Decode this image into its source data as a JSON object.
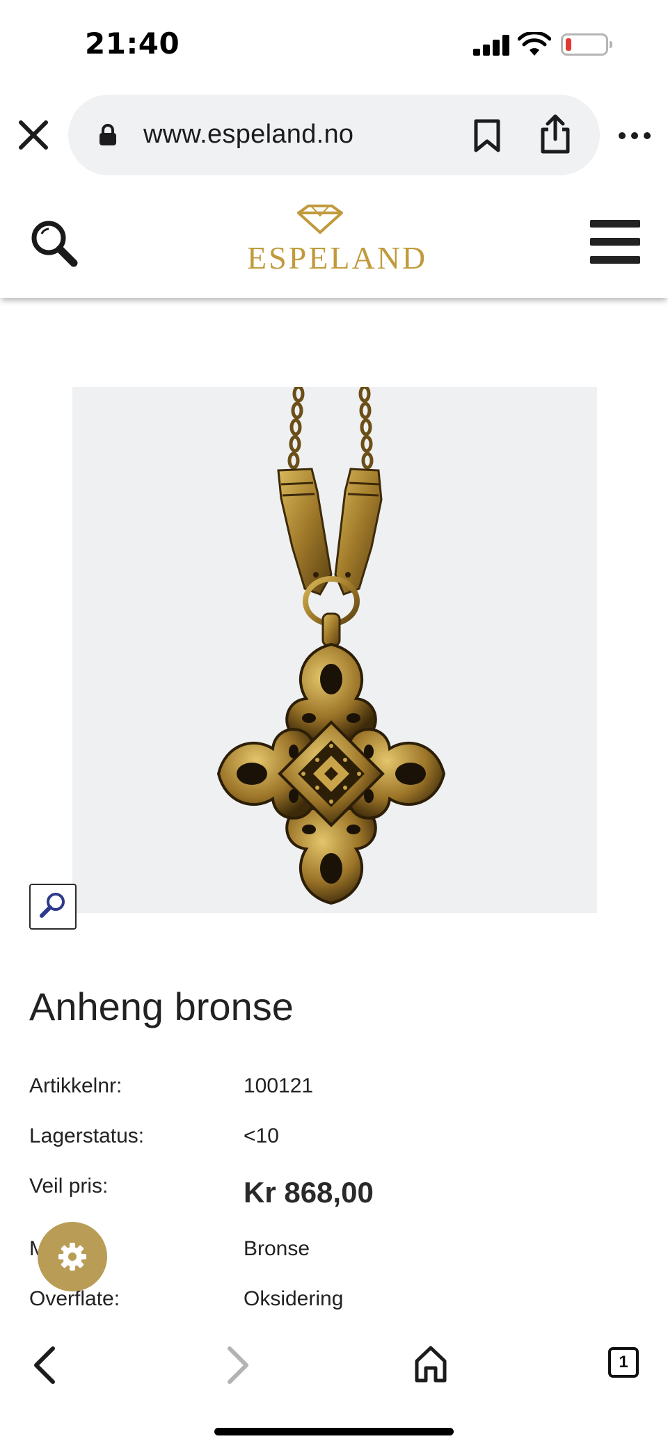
{
  "status_bar": {
    "time": "21:40",
    "battery_state": "low",
    "battery_color": "#e33a2f"
  },
  "browser": {
    "url": "www.espeland.no",
    "close_icon": "close-icon",
    "lock_icon": "lock-icon",
    "bookmark_icon": "bookmark-icon",
    "share_icon": "share-icon",
    "more_icon": "more-icon"
  },
  "site_header": {
    "logo_text": "ESPELAND",
    "brand_color": "#c09a3c",
    "search_icon": "search-icon",
    "menu_icon": "hamburger-menu-icon"
  },
  "product": {
    "title": "Anheng bronse",
    "image_alt": "pendant-image",
    "details": [
      {
        "label": "Artikkelnr:",
        "value": "100121"
      },
      {
        "label": "Lagerstatus:",
        "value": "<10"
      },
      {
        "label": "Veil pris:",
        "value": "Kr 868,00"
      },
      {
        "label": "M",
        "value": "Bronse"
      },
      {
        "label": "Overflate:",
        "value": "Oksidering"
      }
    ]
  },
  "bottom_bar": {
    "tab_count": "1",
    "back_icon": "chevron-left-icon",
    "forward_icon": "chevron-right-icon",
    "home_icon": "home-icon",
    "tabs_icon": "tabs-icon"
  },
  "settings_fab_color": "#b99d56"
}
